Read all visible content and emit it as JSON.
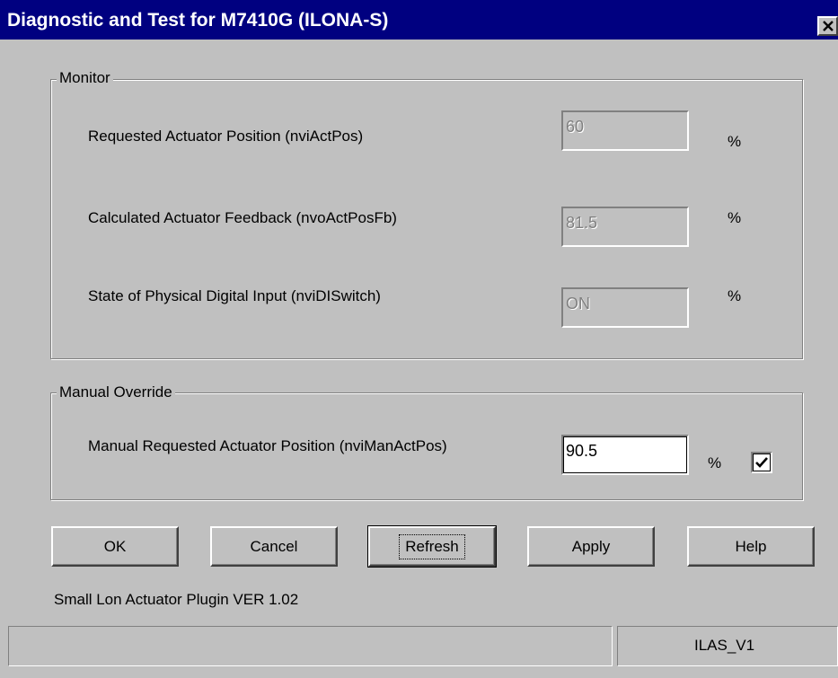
{
  "window": {
    "title": "Diagnostic and Test for M7410G (ILONA-S)"
  },
  "monitor": {
    "legend": "Monitor",
    "rows": [
      {
        "label": "Requested Actuator Position (nviActPos)",
        "value": "60",
        "unit": "%"
      },
      {
        "label": "Calculated Actuator Feedback (nvoActPosFb)",
        "value": "81.5",
        "unit": "%"
      },
      {
        "label": "State of Physical Digital Input (nviDISwitch)",
        "value": "ON",
        "unit": "%"
      }
    ]
  },
  "manual_override": {
    "legend": "Manual Override",
    "label": "Manual Requested Actuator Position (nviManActPos)",
    "value": "90.5",
    "unit": "%",
    "enabled": true
  },
  "buttons": {
    "ok": "OK",
    "cancel": "Cancel",
    "refresh": "Refresh",
    "apply": "Apply",
    "help": "Help"
  },
  "version_text": "Small Lon Actuator Plugin VER 1.02",
  "statusbar": {
    "left": "",
    "right": "ILAS_V1"
  },
  "colors": {
    "titlebar": "#000080",
    "face": "#c0c0c0"
  },
  "icons": {
    "close": "close-icon",
    "check": "checkmark-icon"
  }
}
